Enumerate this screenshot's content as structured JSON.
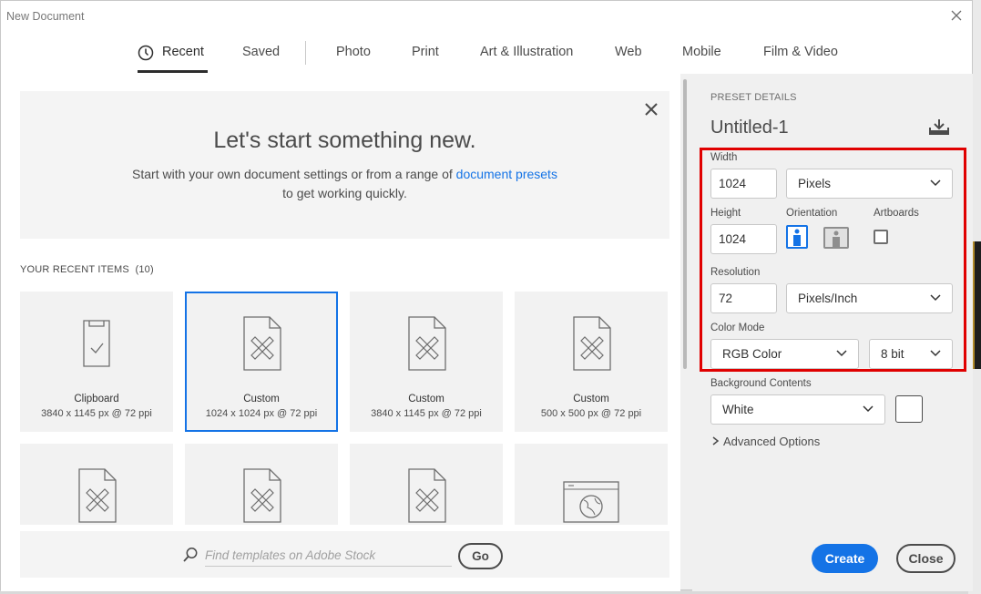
{
  "window": {
    "title": "New Document"
  },
  "tabs": [
    {
      "label": "Recent",
      "active": true
    },
    {
      "label": "Saved"
    },
    {
      "label": "Photo"
    },
    {
      "label": "Print"
    },
    {
      "label": "Art & Illustration"
    },
    {
      "label": "Web"
    },
    {
      "label": "Mobile"
    },
    {
      "label": "Film & Video"
    }
  ],
  "welcome": {
    "heading": "Let's start something new.",
    "line1_prefix": "Start with your own document settings or from a range of ",
    "link": "document presets",
    "line2": "to get working quickly."
  },
  "recent": {
    "header": "YOUR RECENT ITEMS",
    "count": "(10)",
    "items": [
      {
        "name": "Clipboard",
        "size": "3840 x 1145 px @ 72 ppi",
        "icon": "clipboard-icon"
      },
      {
        "name": "Custom",
        "size": "1024 x 1024 px @ 72 ppi",
        "icon": "document-tools-icon",
        "selected": true
      },
      {
        "name": "Custom",
        "size": "3840 x 1145 px @ 72 ppi",
        "icon": "document-tools-icon"
      },
      {
        "name": "Custom",
        "size": "500 x 500 px @ 72 ppi",
        "icon": "document-tools-icon"
      }
    ]
  },
  "search": {
    "placeholder": "Find templates on Adobe Stock",
    "go_label": "Go"
  },
  "preset": {
    "header": "PRESET DETAILS",
    "name": "Untitled-1",
    "width_label": "Width",
    "width": "1024",
    "width_unit": "Pixels",
    "height_label": "Height",
    "height": "1024",
    "orientation_label": "Orientation",
    "artboards_label": "Artboards",
    "resolution_label": "Resolution",
    "resolution": "72",
    "resolution_unit": "Pixels/Inch",
    "color_mode_label": "Color Mode",
    "color_mode": "RGB Color",
    "bit_depth": "8 bit",
    "bg_label": "Background Contents",
    "bg": "White",
    "advanced": "Advanced Options"
  },
  "buttons": {
    "create": "Create",
    "close": "Close"
  },
  "colors": {
    "accent": "#1473e6",
    "highlight": "#e00000"
  }
}
